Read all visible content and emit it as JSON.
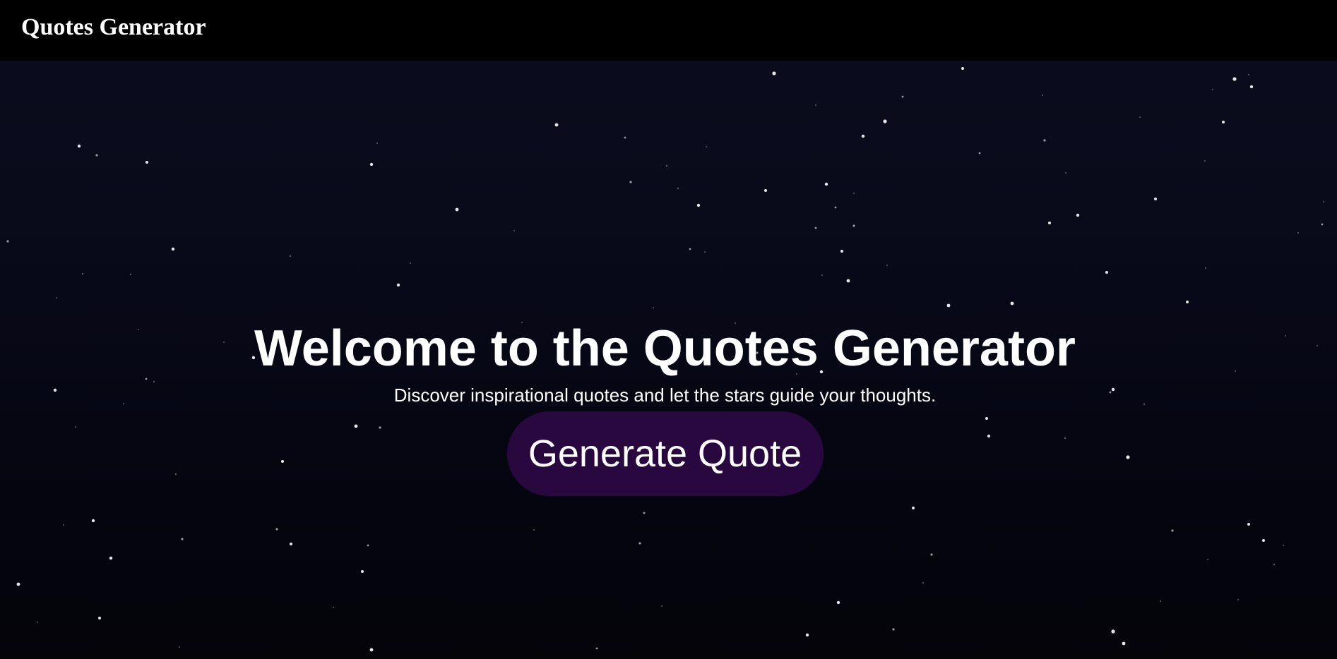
{
  "header": {
    "brand": "Quotes Generator"
  },
  "hero": {
    "title": "Welcome to the Quotes Generator",
    "subtitle": "Discover inspirational quotes and let the stars guide your thoughts.",
    "button_label": "Generate Quote"
  },
  "colors": {
    "navbar_background": "#000000",
    "page_background_top": "#0b0d1f",
    "page_background_bottom": "#040409",
    "button_background": "#28083f",
    "text": "#ffffff",
    "star": "#ffffff"
  }
}
